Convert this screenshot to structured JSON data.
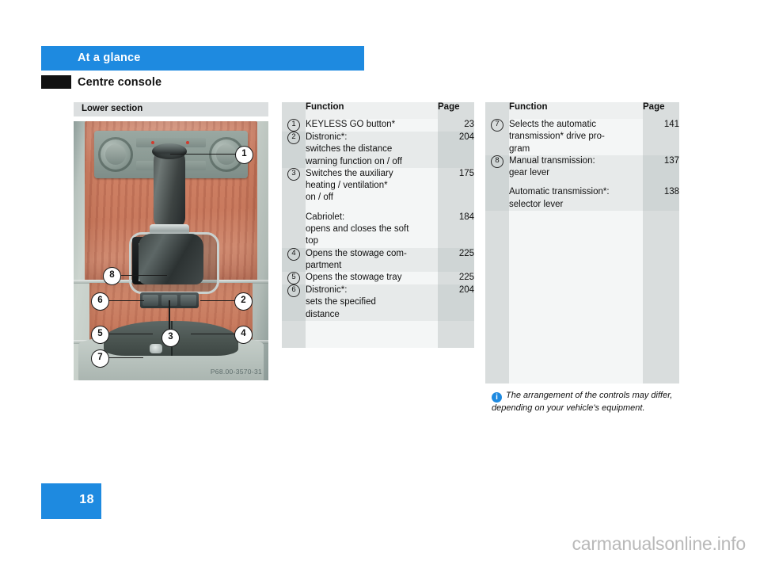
{
  "header": {
    "chapter": "At a glance",
    "section": "Centre console"
  },
  "figure": {
    "caption": "Lower section",
    "image_code": "P68.00-3570-31",
    "callouts": [
      "1",
      "8",
      "7",
      "6",
      "3",
      "5",
      "2",
      "4"
    ]
  },
  "tables": [
    {
      "columns": {
        "number": "",
        "function": "Function",
        "page": "Page"
      },
      "rows": [
        {
          "number": "1",
          "entries": [
            {
              "lines": [
                "KEYLESS GO button*"
              ],
              "page": "23"
            }
          ]
        },
        {
          "number": "2",
          "entries": [
            {
              "lines": [
                "Distronic*:",
                "switches the distance",
                "warning function on / off"
              ],
              "page": "204"
            }
          ]
        },
        {
          "number": "3",
          "entries": [
            {
              "lines": [
                "Switches the auxiliary",
                "heating / ventilation*",
                "on / off"
              ],
              "page": "175"
            },
            {
              "lines": [
                "Cabriolet:",
                "opens and closes the soft",
                "top"
              ],
              "page": "184"
            }
          ]
        },
        {
          "number": "4",
          "entries": [
            {
              "lines": [
                "Opens the stowage com-",
                "partment"
              ],
              "page": "225"
            }
          ]
        },
        {
          "number": "5",
          "entries": [
            {
              "lines": [
                "Opens the stowage tray"
              ],
              "page": "225"
            }
          ]
        },
        {
          "number": "6",
          "entries": [
            {
              "lines": [
                "Distronic*:",
                "sets the specified",
                "distance"
              ],
              "page": "204"
            }
          ]
        }
      ]
    },
    {
      "columns": {
        "number": "",
        "function": "Function",
        "page": "Page"
      },
      "rows": [
        {
          "number": "7",
          "entries": [
            {
              "lines": [
                "Selects the automatic",
                "transmission* drive pro-",
                "gram"
              ],
              "page": "141"
            }
          ]
        },
        {
          "number": "8",
          "entries": [
            {
              "lines": [
                "Manual transmission:",
                "gear lever"
              ],
              "page": "137"
            },
            {
              "lines": [
                "Automatic transmission*:",
                "selector lever"
              ],
              "page": "138"
            }
          ]
        }
      ]
    }
  ],
  "note": {
    "icon": "info-icon",
    "text": "The arrangement of the controls may differ, depending on your vehicle's equipment."
  },
  "footer": {
    "page_number": "18",
    "watermark": "carmanualsonline.info"
  },
  "colors": {
    "accent_blue": "#1e8ae0",
    "table_gray": "#d9dddd",
    "table_light": "#f4f6f6",
    "tab_black": "#111111"
  }
}
